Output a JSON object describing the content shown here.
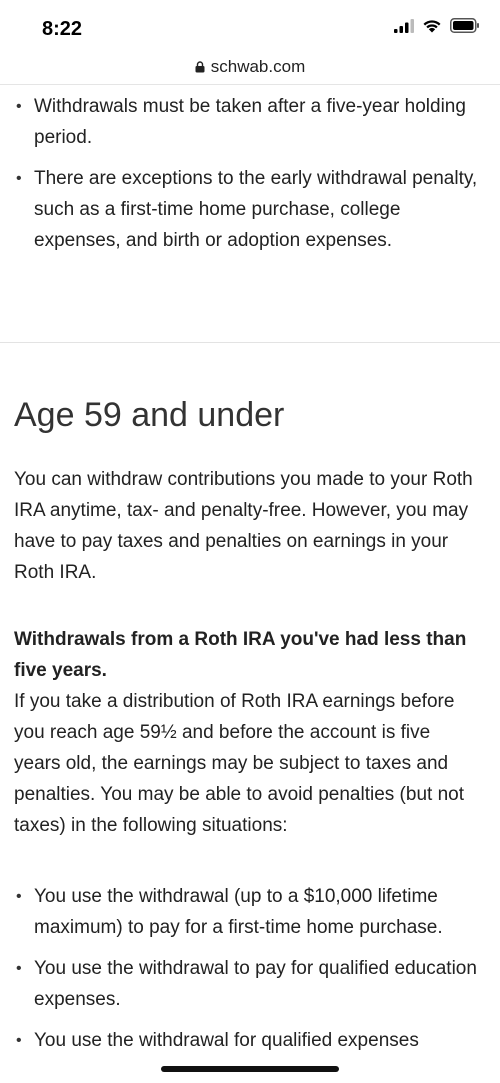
{
  "status_bar": {
    "time": "8:22"
  },
  "browser": {
    "url": "schwab.com"
  },
  "top_bullets": [
    "Withdrawals must be taken after a five-year holding period.",
    "There are exceptions to the early withdrawal penalty, such as a first-time home purchase, college expenses, and birth or adoption expenses."
  ],
  "section": {
    "heading": "Age 59 and under",
    "intro": "You can withdraw contributions you made to your Roth IRA anytime, tax- and penalty-free. However, you may have to pay taxes and penalties on earnings in your Roth IRA.",
    "subheading": "Withdrawals from a Roth IRA you've had less than five years.",
    "subheading_body": "If you take a distribution of Roth IRA earnings before you reach age 59½ and before the account is five years old, the earnings may be subject to taxes and penalties. You may be able to avoid penalties (but not taxes) in the following situations:",
    "bullets": [
      "You use the withdrawal (up to a $10,000 lifetime maximum) to pay for a first-time home purchase.",
      "You use the withdrawal to pay for qualified education expenses.",
      "You use the withdrawal for qualified expenses"
    ]
  },
  "icons": {
    "signal": "cellular-signal-icon",
    "wifi": "wifi-icon",
    "battery": "battery-icon",
    "lock": "lock-icon"
  }
}
